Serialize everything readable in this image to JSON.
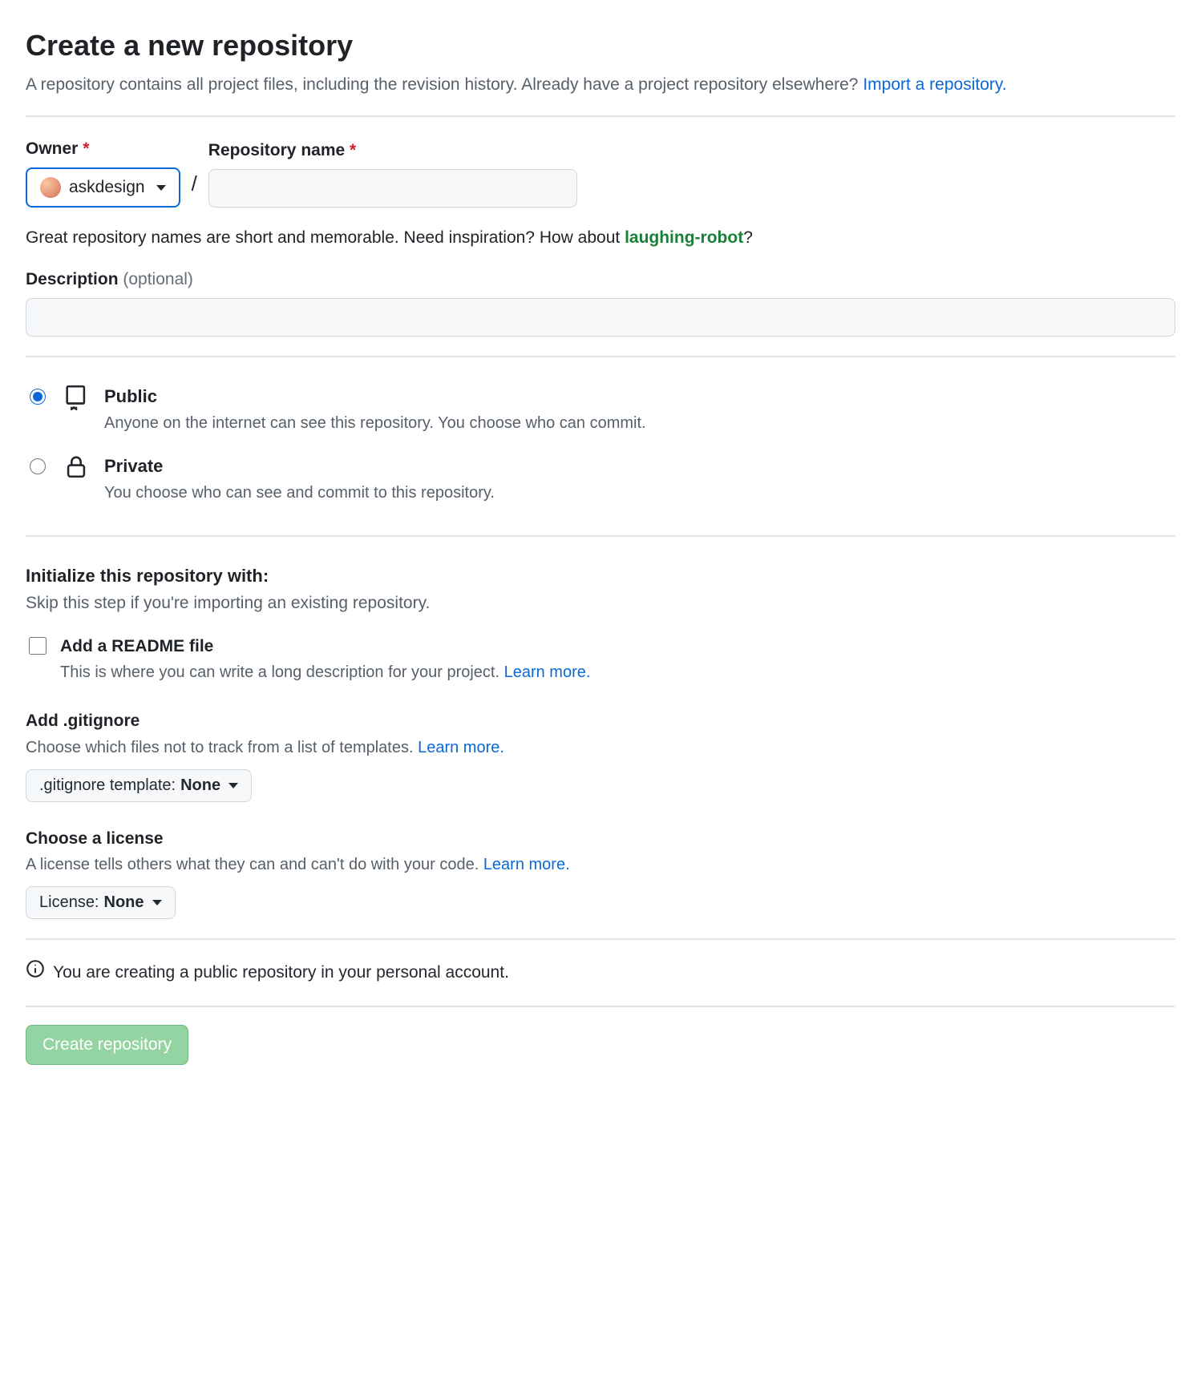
{
  "page": {
    "title": "Create a new repository",
    "subtitle_prefix": "A repository contains all project files, including the revision history. Already have a project repository elsewhere? ",
    "import_link": "Import a repository."
  },
  "owner": {
    "label": "Owner",
    "value": "askdesign"
  },
  "repo_name": {
    "label": "Repository name",
    "value": ""
  },
  "name_hint": {
    "prefix": "Great repository names are short and memorable. Need inspiration? How about ",
    "suggestion": "laughing-robot",
    "suffix": "?"
  },
  "description": {
    "label": "Description",
    "optional": "(optional)",
    "value": ""
  },
  "visibility": {
    "public": {
      "title": "Public",
      "desc": "Anyone on the internet can see this repository. You choose who can commit."
    },
    "private": {
      "title": "Private",
      "desc": "You choose who can see and commit to this repository."
    }
  },
  "initialize": {
    "heading": "Initialize this repository with:",
    "sub": "Skip this step if you're importing an existing repository."
  },
  "readme": {
    "title": "Add a README file",
    "desc_prefix": "This is where you can write a long description for your project. ",
    "learn_more": "Learn more."
  },
  "gitignore": {
    "title": "Add .gitignore",
    "desc_prefix": "Choose which files not to track from a list of templates. ",
    "learn_more": "Learn more.",
    "select_prefix": ".gitignore template: ",
    "select_value": "None"
  },
  "license": {
    "title": "Choose a license",
    "desc_prefix": "A license tells others what they can and can't do with your code. ",
    "learn_more": "Learn more.",
    "select_prefix": "License: ",
    "select_value": "None"
  },
  "info_notice": "You are creating a public repository in your personal account.",
  "submit_label": "Create repository"
}
